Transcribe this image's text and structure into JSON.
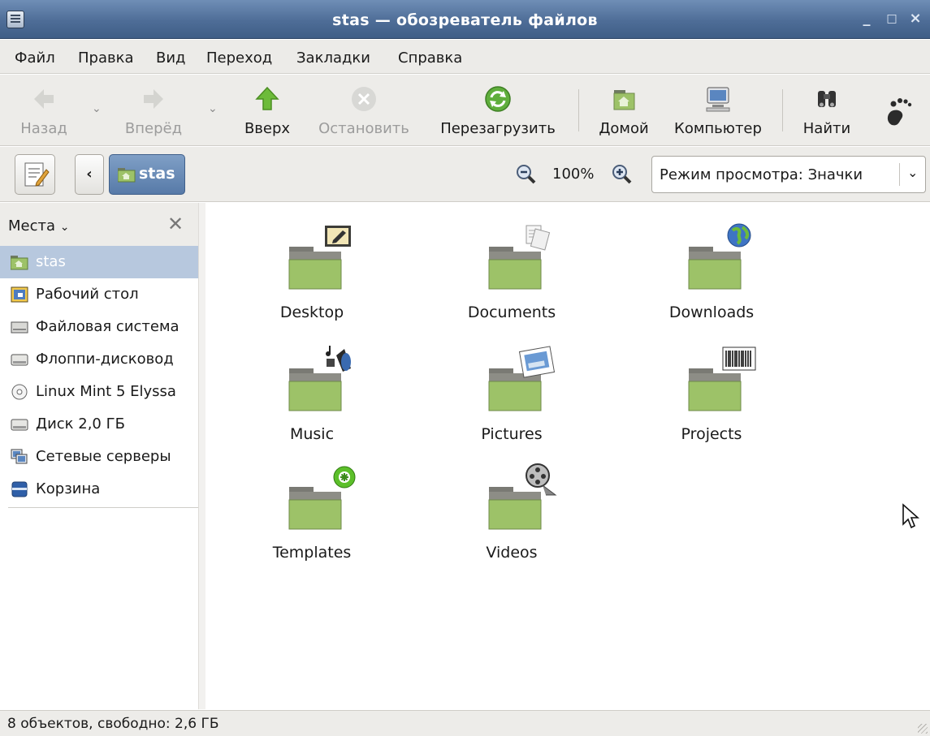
{
  "window": {
    "title": "stas — обозреватель файлов"
  },
  "menu": [
    "Файл",
    "Правка",
    "Вид",
    "Переход",
    "Закладки",
    "Справка"
  ],
  "toolbar": {
    "back": "Назад",
    "forward": "Вперёд",
    "up": "Вверх",
    "stop": "Остановить",
    "reload": "Перезагрузить",
    "home": "Домой",
    "computer": "Компьютер",
    "search": "Найти"
  },
  "location": {
    "crumb": "stas",
    "zoom": "100%",
    "view_mode": "Режим просмотра: Значки"
  },
  "sidebar": {
    "header": "Места",
    "items": [
      {
        "label": "stas",
        "icon": "home-folder-icon"
      },
      {
        "label": "Рабочий стол",
        "icon": "desktop-icon"
      },
      {
        "label": "Файловая система",
        "icon": "filesystem-icon"
      },
      {
        "label": "Флоппи-дисковод",
        "icon": "floppy-icon"
      },
      {
        "label": "Linux Mint 5 Elyssa",
        "icon": "cdrom-icon"
      },
      {
        "label": "Диск 2,0 ГБ",
        "icon": "drive-icon"
      },
      {
        "label": "Сетевые серверы",
        "icon": "network-icon"
      },
      {
        "label": "Корзина",
        "icon": "trash-icon"
      }
    ]
  },
  "folders": [
    {
      "name": "Desktop",
      "emblem": "desktop-emblem-icon"
    },
    {
      "name": "Documents",
      "emblem": "documents-emblem-icon"
    },
    {
      "name": "Downloads",
      "emblem": "globe-emblem-icon"
    },
    {
      "name": "Music",
      "emblem": "music-emblem-icon"
    },
    {
      "name": "Pictures",
      "emblem": "picture-emblem-icon"
    },
    {
      "name": "Projects",
      "emblem": "barcode-emblem-icon"
    },
    {
      "name": "Templates",
      "emblem": "template-emblem-icon"
    },
    {
      "name": "Videos",
      "emblem": "film-emblem-icon"
    }
  ],
  "status": {
    "text": "8 объектов, свободно: 2,6 ГБ"
  },
  "colors": {
    "titlebar": "#4e6d97",
    "folder_green": "#9dc268",
    "selection": "#b7c8de"
  }
}
